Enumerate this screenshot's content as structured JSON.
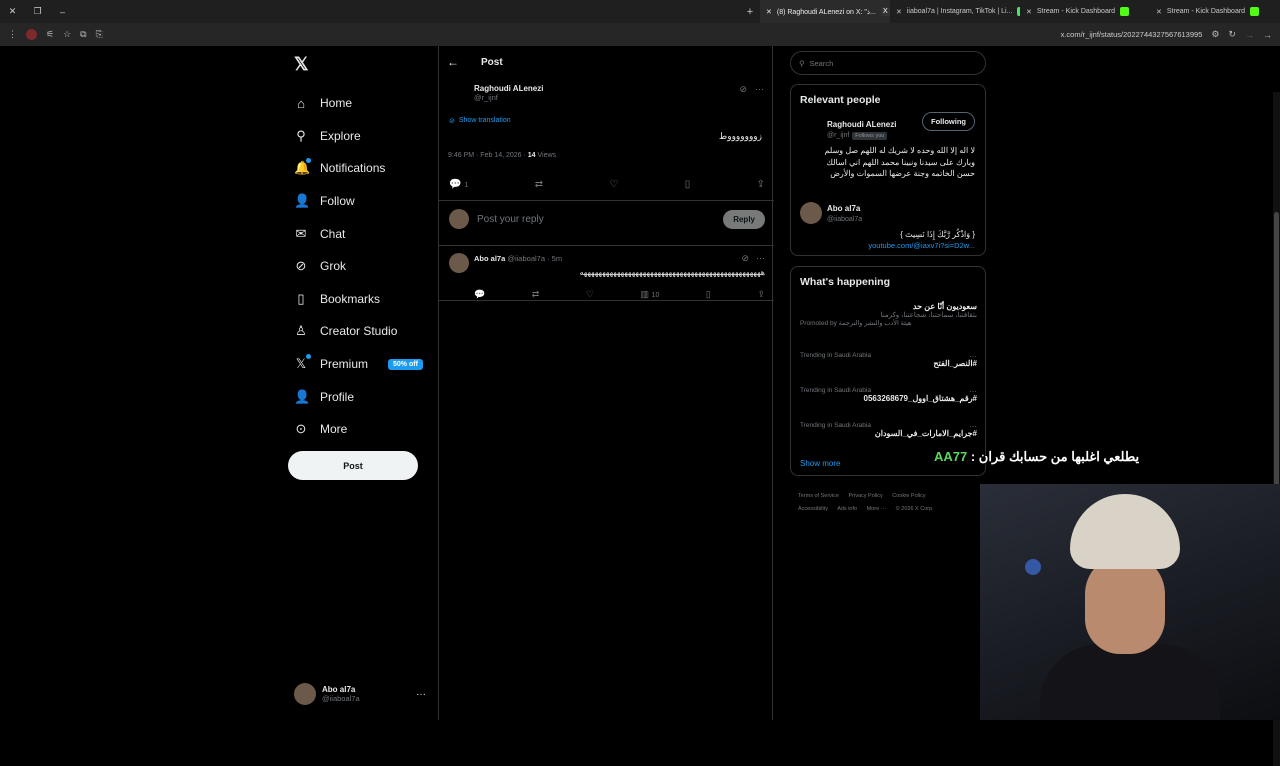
{
  "browser": {
    "tabs": [
      {
        "label": "(8) Raghoudi ALenezi on X: \"ذ...",
        "active": true
      },
      {
        "label": "iiaboal7a | Instagram, TikTok | Li...",
        "active": false
      },
      {
        "label": "Stream - Kick Dashboard",
        "active": false
      },
      {
        "label": "Stream - Kick Dashboard",
        "active": false
      }
    ],
    "url": "x.com/r_ijnf/status/2022744327567613995"
  },
  "nav": {
    "items": [
      {
        "label": "Home",
        "icon": "home-icon",
        "glyph": "⌂"
      },
      {
        "label": "Explore",
        "icon": "search-icon",
        "glyph": "⚲"
      },
      {
        "label": "Notifications",
        "icon": "bell-icon",
        "glyph": "🔔"
      },
      {
        "label": "Follow",
        "icon": "follow-icon",
        "glyph": "👤"
      },
      {
        "label": "Chat",
        "icon": "mail-icon",
        "glyph": "✉"
      },
      {
        "label": "Grok",
        "icon": "grok-icon",
        "glyph": "⊘"
      },
      {
        "label": "Bookmarks",
        "icon": "bookmark-icon",
        "glyph": "▯"
      },
      {
        "label": "Creator Studio",
        "icon": "creator-icon",
        "glyph": "♙"
      },
      {
        "label": "Premium",
        "icon": "x-icon",
        "glyph": "𝕏",
        "badge": "50% off"
      },
      {
        "label": "Profile",
        "icon": "profile-icon",
        "glyph": "👤"
      },
      {
        "label": "More",
        "icon": "more-circle-icon",
        "glyph": "⊙"
      }
    ],
    "post_label": "Post",
    "account": {
      "name": "Abo al7a",
      "handle": "@iiaboal7a"
    }
  },
  "center": {
    "header_title": "Post",
    "post": {
      "name": "Raghoudi ALenezi",
      "handle": "@r_ijnf",
      "show_translation": "Show translation",
      "text": "زوووووووط",
      "time": "9:46 PM · Feb 14, 2026 · ",
      "views_count": "14",
      "views_label": " Views",
      "reply_count": "1"
    },
    "reply_box": {
      "placeholder": "Post your reply",
      "button": "Reply"
    },
    "reply": {
      "name": "Abo al7a",
      "handle": "@iiaboal7a · 5m",
      "text": "هههههههههههههههههههههههههههههههههههههههههههههههههه",
      "views": "10"
    }
  },
  "right": {
    "search_placeholder": "Search",
    "relevant_title": "Relevant people",
    "person1": {
      "name": "Raghoudi ALenezi",
      "handle": "@r_ijnf",
      "follows_you": "Follows you",
      "button": "Following",
      "bio": "لا اله إلا الله وحده لا شريك له اللهم صل وسلم وبارك على سيدنا ونبينا محمد اللهم اني اسالك حسن الخاتمه وجنة عرضها السموات والأرض"
    },
    "person2": {
      "name": "Abo al7a",
      "handle": "@iiaboal7a",
      "bio": "{ وَاذْكُر رَّبَّكَ إِذَا نَسِيتَ }",
      "link": "youtube.com/@iaxv7i?si=D2w..."
    },
    "happening_title": "What's happening",
    "promo": {
      "title": "سعوديون أنّا عن حد",
      "sub": "بثقافتنا، سماحتنا، شجاعتنا، وكرمنا",
      "promoted": "Promoted by هيئة الأدب والنشر والترجمة"
    },
    "trends": [
      {
        "context": "Trending in Saudi Arabia",
        "tag": "#النصر_الفتح"
      },
      {
        "context": "Trending in Saudi Arabia",
        "tag": "#رقم_هشتاق_اوول_0563268679"
      },
      {
        "context": "Trending in Saudi Arabia",
        "tag": "#جرايم_الامارات_في_السودان"
      }
    ],
    "show_more": "Show more",
    "footer": [
      "Terms of Service",
      "Privacy Policy",
      "Cookie Policy",
      "Accessibility",
      "Ads info",
      "More ···",
      "© 2026 X Corp."
    ]
  },
  "overlay": {
    "prefix": "يطلعي اغلبها من حسابك قران : ",
    "highlight": "AA77"
  },
  "colors": {
    "accent": "#1d9bf0",
    "background": "#000000",
    "border": "#2f3336",
    "muted": "#71767b"
  }
}
